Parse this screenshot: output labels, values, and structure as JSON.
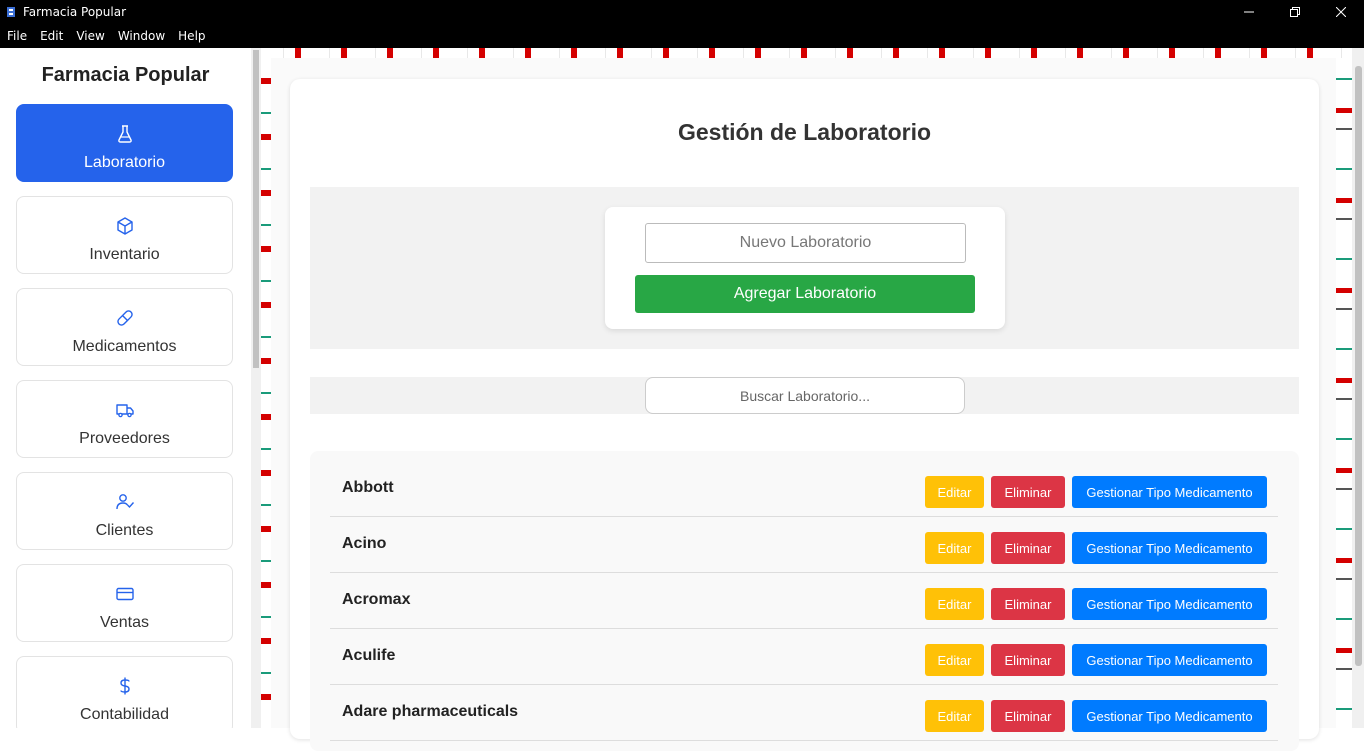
{
  "window": {
    "title": "Farmacia Popular",
    "menu": [
      "File",
      "Edit",
      "View",
      "Window",
      "Help"
    ]
  },
  "sidebar": {
    "brand": "Farmacia Popular",
    "items": [
      {
        "label": "Laboratorio",
        "icon": "flask-icon",
        "active": true
      },
      {
        "label": "Inventario",
        "icon": "box-icon",
        "active": false
      },
      {
        "label": "Medicamentos",
        "icon": "pill-icon",
        "active": false
      },
      {
        "label": "Proveedores",
        "icon": "truck-icon",
        "active": false
      },
      {
        "label": "Clientes",
        "icon": "user-check-icon",
        "active": false
      },
      {
        "label": "Ventas",
        "icon": "credit-card-icon",
        "active": false
      },
      {
        "label": "Contabilidad",
        "icon": "dollar-icon",
        "active": false
      }
    ]
  },
  "main": {
    "title": "Gestión de Laboratorio",
    "new_lab_placeholder": "Nuevo Laboratorio",
    "add_button": "Agregar Laboratorio",
    "search_placeholder": "Buscar Laboratorio...",
    "edit_label": "Editar",
    "delete_label": "Eliminar",
    "manage_label": "Gestionar Tipo Medicamento",
    "labs": [
      "Abbott",
      "Acino",
      "Acromax",
      "Aculife",
      "Adare pharmaceuticals"
    ]
  },
  "colors": {
    "accent": "#2563eb",
    "success": "#28a745",
    "warning": "#ffc107",
    "danger": "#dc3545",
    "primary": "#007bff"
  }
}
